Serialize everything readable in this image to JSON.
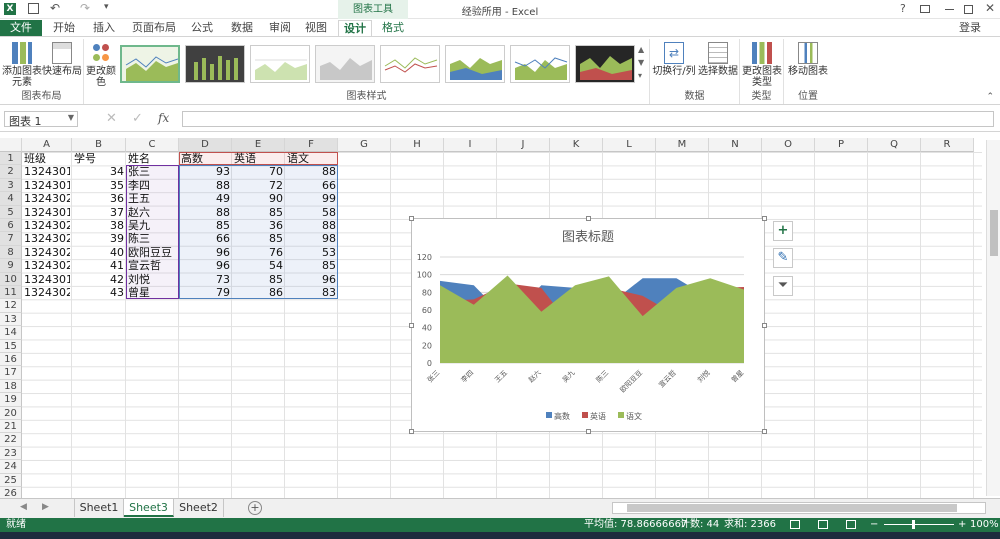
{
  "app": {
    "title": "经验所用 - Excel",
    "contextual_group": "图表工具",
    "login_label": "登录"
  },
  "tabs": [
    "文件",
    "开始",
    "插入",
    "页面布局",
    "公式",
    "数据",
    "审阅",
    "视图",
    "设计",
    "格式"
  ],
  "ribbon": {
    "add_element_label": "添加图表元素",
    "quick_layout_label": "快速布局",
    "layout_group": "图表布局",
    "change_color_label": "更改颜色",
    "styles_group": "图表样式",
    "switch_label": "切换行/列",
    "select_data_label": "选择数据",
    "data_group": "数据",
    "change_type_label": "更改图表类型",
    "type_group": "类型",
    "move_chart_label": "移动图表",
    "location_group": "位置"
  },
  "formula_bar": {
    "name_box": "图表 1",
    "fx_label": "fx",
    "formula": ""
  },
  "columns": [
    "A",
    "B",
    "C",
    "D",
    "E",
    "F",
    "G",
    "H",
    "I",
    "J",
    "K",
    "L",
    "M",
    "N",
    "O",
    "P",
    "Q",
    "R"
  ],
  "rows": [
    "1",
    "2",
    "3",
    "4",
    "5",
    "6",
    "7",
    "8",
    "9",
    "10",
    "11",
    "12",
    "13",
    "14",
    "15",
    "16",
    "17",
    "18",
    "19",
    "20",
    "21",
    "22",
    "23",
    "24",
    "25",
    "26"
  ],
  "headers": [
    "班级",
    "学号",
    "姓名",
    "高数",
    "英语",
    "语文"
  ],
  "data_rows": [
    [
      "1324301",
      "34",
      "张三",
      "93",
      "70",
      "88"
    ],
    [
      "1324301",
      "35",
      "李四",
      "88",
      "72",
      "66"
    ],
    [
      "1324302",
      "36",
      "王五",
      "49",
      "90",
      "99"
    ],
    [
      "1324301",
      "37",
      "赵六",
      "88",
      "85",
      "58"
    ],
    [
      "1324302",
      "38",
      "吴九",
      "85",
      "36",
      "88"
    ],
    [
      "1324302",
      "39",
      "陈三",
      "66",
      "85",
      "98"
    ],
    [
      "1324302",
      "40",
      "欧阳豆豆",
      "96",
      "76",
      "53"
    ],
    [
      "1324302",
      "41",
      "宣云哲",
      "96",
      "54",
      "85"
    ],
    [
      "1324301",
      "42",
      "刘悦",
      "73",
      "85",
      "96"
    ],
    [
      "1324302",
      "43",
      "曾星",
      "79",
      "86",
      "83"
    ]
  ],
  "sheets": [
    "Sheet1",
    "Sheet3",
    "Sheet2"
  ],
  "active_sheet": "Sheet3",
  "status": {
    "ready": "就绪",
    "average": "平均值: 78.86666667",
    "count": "计数: 44",
    "sum": "求和: 2366",
    "zoom": "100%"
  },
  "colors": {
    "excel_green": "#217346",
    "series_1": "#4f81bd",
    "series_2": "#c0504d",
    "series_3": "#9bbb59"
  },
  "chart_data": {
    "type": "area",
    "title": "图表标题",
    "categories": [
      "张三",
      "李四",
      "王五",
      "赵六",
      "吴九",
      "陈三",
      "欧阳豆豆",
      "宣云哲",
      "刘悦",
      "曾星"
    ],
    "series": [
      {
        "name": "高数",
        "values": [
          93,
          88,
          49,
          88,
          85,
          66,
          96,
          96,
          73,
          79
        ],
        "color": "#4f81bd"
      },
      {
        "name": "英语",
        "values": [
          70,
          72,
          90,
          85,
          36,
          85,
          76,
          54,
          85,
          86
        ],
        "color": "#c0504d"
      },
      {
        "name": "语文",
        "values": [
          88,
          66,
          99,
          58,
          88,
          98,
          53,
          85,
          96,
          83
        ],
        "color": "#9bbb59"
      }
    ],
    "yticks": [
      "0",
      "20",
      "40",
      "60",
      "80",
      "100",
      "120"
    ],
    "ylim": [
      0,
      120
    ],
    "grid": true,
    "legend": "bottom"
  }
}
